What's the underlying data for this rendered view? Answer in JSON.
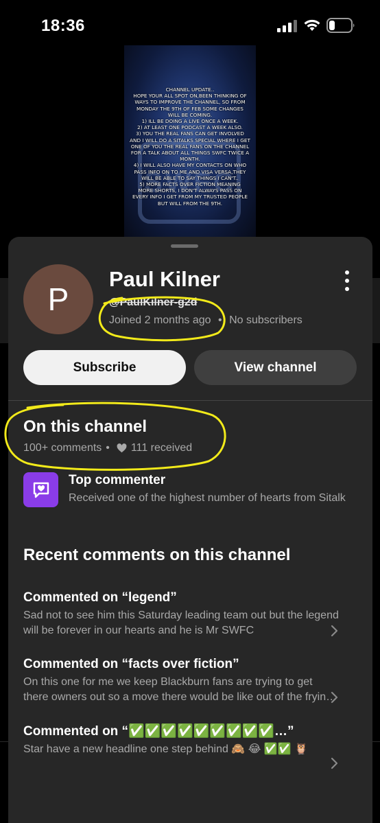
{
  "status_bar": {
    "time": "18:36"
  },
  "background_post": {
    "lines": [
      "CHANNEL UPDATE..",
      "HOPE YOUR ALL SPOT ON,BEEN THINKING OF",
      "WAYS TO IMPROVE THE CHANNEL, SO FROM",
      "MONDAY THE 9TH OF FEB SOME CHANGES",
      "WILL BE COMING.",
      "1) ILL BE DOING A LIVE ONCE A WEEK.",
      "2) AT LEAST ONE PODCAST A WEEK ALSO.",
      "3) YOU THE REAL FANS CAN GET INVOLVED",
      "AND I WILL DO A SITALKS SPECIAL WHERE I GET",
      "ONE OF YOU THE REAL FANS ON THE CHANNEL",
      "FOR A TALK ABOUT ALL THINGS SWFC TWICE A",
      "MONTH.",
      "4) I WILL ALSO HAVE MY CONTACTS ON WHO",
      "PASS INFO ON TO ME AND VISA VERSA,THEY",
      "WILL BE ABLE TO SAY THINGS I CAN'T..",
      "5) MORE FACTS OVER FICTION MEANING",
      "MORE SHORTS, I DON'T ALWAYS PASS ON",
      "EVERY INFO I GET FROM MY TRUSTED PEOPLE",
      "BUT WILL FROM THE 9TH."
    ],
    "crest_text": "SWFC"
  },
  "profile": {
    "avatar_letter": "P",
    "avatar_color": "#6a4a3e",
    "name": "Paul Kilner",
    "handle": "@PaulKilner-g2d",
    "joined": "Joined 2 months ago",
    "separator": "•",
    "subscribers": "No subscribers"
  },
  "actions": {
    "subscribe": "Subscribe",
    "view_channel": "View channel"
  },
  "on_channel": {
    "title": "On this channel",
    "comments": "100+ comments",
    "separator": "•",
    "hearts": "111 received"
  },
  "badge": {
    "title": "Top commenter",
    "description": "Received one of the highest number of hearts from Sitalk",
    "color": "#8a3ce8"
  },
  "recent": {
    "title": "Recent comments on this channel",
    "items": [
      {
        "heading": "Commented on “legend”",
        "body": "Sad not to see him this Saturday leading team out but the legend will be forever in our hearts and he is Mr SWFC"
      },
      {
        "heading": "Commented on “facts over fiction”",
        "body": "On this one for me we keep Blackburn fans are trying to get there owners out so a move there would be like out of the frying pan"
      },
      {
        "heading": "Commented on “✅✅✅✅✅✅✅✅✅…”",
        "body": "Star have a new headline one step behind 🙈 😂 ✅✅ 🦉"
      }
    ]
  },
  "annotation_color": "#f2ea1a"
}
